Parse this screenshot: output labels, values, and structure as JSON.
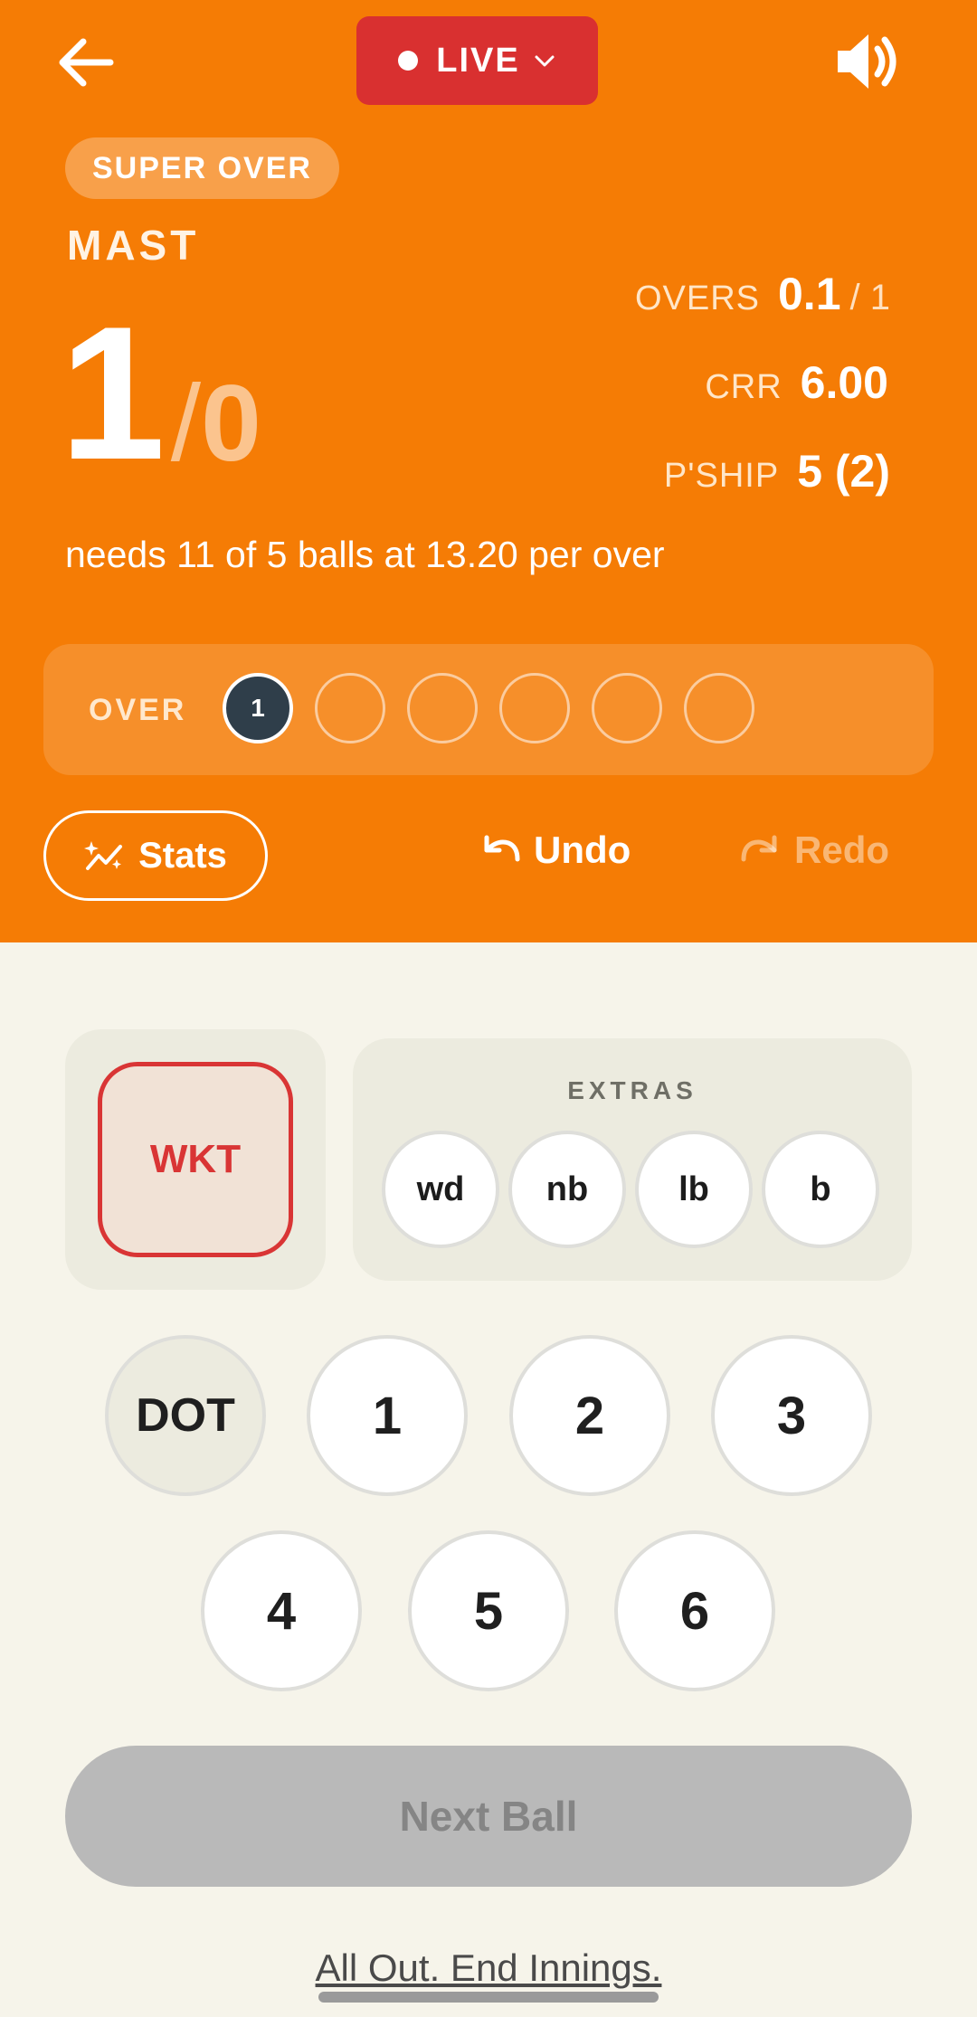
{
  "header": {
    "live_label": "LIVE",
    "badge": "SUPER OVER",
    "team": "MAST",
    "score": {
      "runs": "1",
      "separator": "/",
      "wickets": "0"
    },
    "overs": {
      "label": "OVERS",
      "value": "0.1",
      "total": "/ 1"
    },
    "crr": {
      "label": "CRR",
      "value": "6.00"
    },
    "partnership": {
      "label": "P'SHIP",
      "value": "5 (2)"
    },
    "needs_text": "needs 11 of 5 balls at 13.20 per over"
  },
  "over_tracker": {
    "label": "OVER",
    "balls": [
      "1",
      "",
      "",
      "",
      "",
      ""
    ]
  },
  "actions": {
    "stats_label": "Stats",
    "undo_label": "Undo",
    "redo_label": "Redo"
  },
  "scoring": {
    "wicket_label": "WKT",
    "extras_title": "EXTRAS",
    "extras": [
      "wd",
      "nb",
      "lb",
      "b"
    ],
    "runs": [
      "DOT",
      "1",
      "2",
      "3",
      "4",
      "5",
      "6"
    ],
    "next_ball_label": "Next Ball",
    "end_innings_label": "All Out. End Innings."
  },
  "colors": {
    "header_bg": "#f57c05",
    "live_bg": "#d93030",
    "wicket_accent": "#d93535",
    "page_bg": "#f6f4ea"
  },
  "icons": {
    "back": "arrow-left-icon",
    "live": "chevron-down-icon",
    "sound": "speaker-icon",
    "stats": "sparkle-chart-icon",
    "undo": "undo-icon",
    "redo": "redo-icon"
  }
}
